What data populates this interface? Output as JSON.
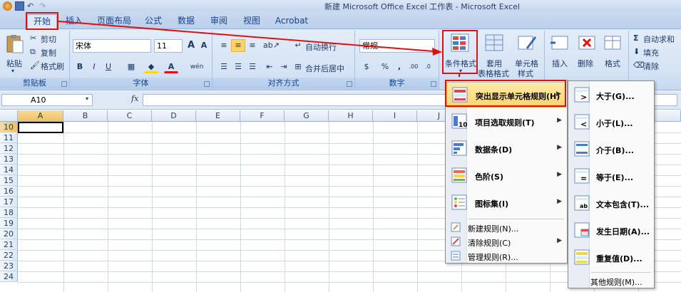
{
  "window": {
    "title": "新建 Microsoft Office Excel 工作表 - Microsoft Excel"
  },
  "tabs": [
    "开始",
    "插入",
    "页面布局",
    "公式",
    "数据",
    "审阅",
    "视图",
    "Acrobat"
  ],
  "ribbon": {
    "clipboard": {
      "label": "剪贴板",
      "paste": "粘贴",
      "cut": "剪切",
      "copy": "复制",
      "format_painter": "格式刷"
    },
    "font": {
      "label": "字体",
      "name": "宋体",
      "size": "11",
      "bold": "B",
      "italic": "I",
      "underline": "U",
      "grow": "A",
      "shrink": "A",
      "color": "A",
      "phonetic": "wén"
    },
    "alignment": {
      "label": "对齐方式",
      "wrap": "自动换行",
      "merge": "合并后居中"
    },
    "number": {
      "label": "数字",
      "format": "常规",
      "percent": "%",
      "comma": ",",
      "inc_decimal": ".00",
      "dec_decimal": ".0"
    },
    "styles": {
      "conditional": "条件格式",
      "table_1": "套用",
      "table_2": "表格格式",
      "cell_1": "单元格",
      "cell_2": "样式"
    },
    "cells": {
      "insert": "插入",
      "delete": "删除",
      "format": "格式"
    },
    "editing": {
      "autosum": "自动求和",
      "fill": "填充",
      "clear": "清除"
    }
  },
  "formula_bar": {
    "name_box": "A10",
    "fx": "fx",
    "value": ""
  },
  "columns": [
    "A",
    "B",
    "C",
    "D",
    "E",
    "F",
    "G",
    "H",
    "I",
    "J"
  ],
  "rows": [
    "10",
    "11",
    "12",
    "13",
    "14",
    "15",
    "16",
    "17",
    "18",
    "19",
    "20",
    "21",
    "22",
    "23",
    "24"
  ],
  "cond_menu": {
    "items": [
      {
        "label": "突出显示单元格规则(H)"
      },
      {
        "label": "项目选取规则(T)"
      },
      {
        "label": "数据条(D)"
      },
      {
        "label": "色阶(S)"
      },
      {
        "label": "图标集(I)"
      }
    ],
    "small_items": [
      {
        "label": "新建规则(N)..."
      },
      {
        "label": "清除规则(C)"
      },
      {
        "label": "管理规则(R)..."
      }
    ]
  },
  "highlight_submenu": {
    "items": [
      {
        "label": "大于(G)..."
      },
      {
        "label": "小于(L)..."
      },
      {
        "label": "介于(B)..."
      },
      {
        "label": "等于(E)..."
      },
      {
        "label": "文本包含(T)..."
      },
      {
        "label": "发生日期(A)..."
      },
      {
        "label": "重复值(D)..."
      }
    ],
    "more": "其他规则(M)..."
  },
  "colors": {
    "red": "#e01010",
    "accent": "#15428b",
    "menu_hl": "#fbd56a"
  }
}
